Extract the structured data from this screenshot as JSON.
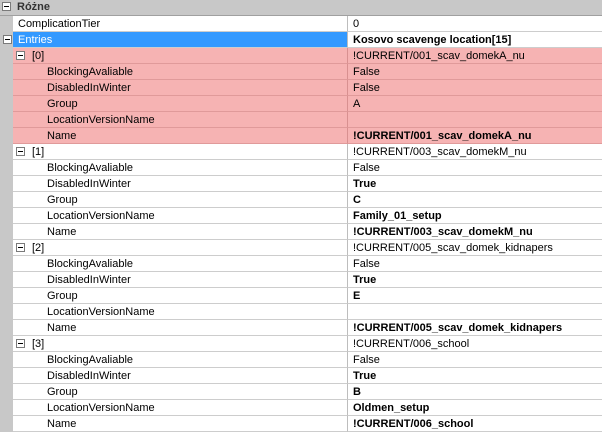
{
  "category": {
    "label": "Różne"
  },
  "rows": [
    {
      "id": "complication-tier",
      "name": "ComplicationTier",
      "value": "0",
      "bold": false,
      "indent": 0,
      "expander": false,
      "style": "normal"
    },
    {
      "id": "entries",
      "name": "Entries",
      "value": "Kosovo scavenge location[15]",
      "bold": true,
      "indent": 0,
      "expander": true,
      "style": "selected"
    },
    {
      "id": "entry-0",
      "name": "[0]",
      "value": "!CURRENT/001_scav_domekA_nu",
      "bold": false,
      "indent": 1,
      "expander": true,
      "style": "pink"
    },
    {
      "id": "entry-0-blocking",
      "name": "BlockingAvaliable",
      "value": "False",
      "bold": false,
      "indent": 2,
      "expander": false,
      "style": "pink"
    },
    {
      "id": "entry-0-disabled",
      "name": "DisabledInWinter",
      "value": "False",
      "bold": false,
      "indent": 2,
      "expander": false,
      "style": "pink"
    },
    {
      "id": "entry-0-group",
      "name": "Group",
      "value": "A",
      "bold": false,
      "indent": 2,
      "expander": false,
      "style": "pink"
    },
    {
      "id": "entry-0-location",
      "name": "LocationVersionName",
      "value": "",
      "bold": false,
      "indent": 2,
      "expander": false,
      "style": "pink"
    },
    {
      "id": "entry-0-name",
      "name": "Name",
      "value": "!CURRENT/001_scav_domekA_nu",
      "bold": true,
      "indent": 2,
      "expander": false,
      "style": "pink"
    },
    {
      "id": "entry-1",
      "name": "[1]",
      "value": "!CURRENT/003_scav_domekM_nu",
      "bold": false,
      "indent": 1,
      "expander": true,
      "style": "normal"
    },
    {
      "id": "entry-1-blocking",
      "name": "BlockingAvaliable",
      "value": "False",
      "bold": false,
      "indent": 2,
      "expander": false,
      "style": "normal"
    },
    {
      "id": "entry-1-disabled",
      "name": "DisabledInWinter",
      "value": "True",
      "bold": true,
      "indent": 2,
      "expander": false,
      "style": "normal"
    },
    {
      "id": "entry-1-group",
      "name": "Group",
      "value": "C",
      "bold": true,
      "indent": 2,
      "expander": false,
      "style": "normal"
    },
    {
      "id": "entry-1-location",
      "name": "LocationVersionName",
      "value": "Family_01_setup",
      "bold": true,
      "indent": 2,
      "expander": false,
      "style": "normal"
    },
    {
      "id": "entry-1-name",
      "name": "Name",
      "value": "!CURRENT/003_scav_domekM_nu",
      "bold": true,
      "indent": 2,
      "expander": false,
      "style": "normal"
    },
    {
      "id": "entry-2",
      "name": "[2]",
      "value": "!CURRENT/005_scav_domek_kidnapers",
      "bold": false,
      "indent": 1,
      "expander": true,
      "style": "normal"
    },
    {
      "id": "entry-2-blocking",
      "name": "BlockingAvaliable",
      "value": "False",
      "bold": false,
      "indent": 2,
      "expander": false,
      "style": "normal"
    },
    {
      "id": "entry-2-disabled",
      "name": "DisabledInWinter",
      "value": "True",
      "bold": true,
      "indent": 2,
      "expander": false,
      "style": "normal"
    },
    {
      "id": "entry-2-group",
      "name": "Group",
      "value": "E",
      "bold": true,
      "indent": 2,
      "expander": false,
      "style": "normal"
    },
    {
      "id": "entry-2-location",
      "name": "LocationVersionName",
      "value": "",
      "bold": false,
      "indent": 2,
      "expander": false,
      "style": "normal"
    },
    {
      "id": "entry-2-name",
      "name": "Name",
      "value": "!CURRENT/005_scav_domek_kidnapers",
      "bold": true,
      "indent": 2,
      "expander": false,
      "style": "normal"
    },
    {
      "id": "entry-3",
      "name": "[3]",
      "value": "!CURRENT/006_school",
      "bold": false,
      "indent": 1,
      "expander": true,
      "style": "normal"
    },
    {
      "id": "entry-3-blocking",
      "name": "BlockingAvaliable",
      "value": "False",
      "bold": false,
      "indent": 2,
      "expander": false,
      "style": "normal"
    },
    {
      "id": "entry-3-disabled",
      "name": "DisabledInWinter",
      "value": "True",
      "bold": true,
      "indent": 2,
      "expander": false,
      "style": "normal"
    },
    {
      "id": "entry-3-group",
      "name": "Group",
      "value": "B",
      "bold": true,
      "indent": 2,
      "expander": false,
      "style": "normal"
    },
    {
      "id": "entry-3-location",
      "name": "LocationVersionName",
      "value": "Oldmen_setup",
      "bold": true,
      "indent": 2,
      "expander": false,
      "style": "normal"
    },
    {
      "id": "entry-3-name",
      "name": "Name",
      "value": "!CURRENT/006_school",
      "bold": true,
      "indent": 2,
      "expander": false,
      "style": "normal"
    }
  ],
  "colors": {
    "category_bg": "#c8c8c8",
    "selection_bg": "#3399ff",
    "highlight_bg": "#f6b3b3"
  }
}
